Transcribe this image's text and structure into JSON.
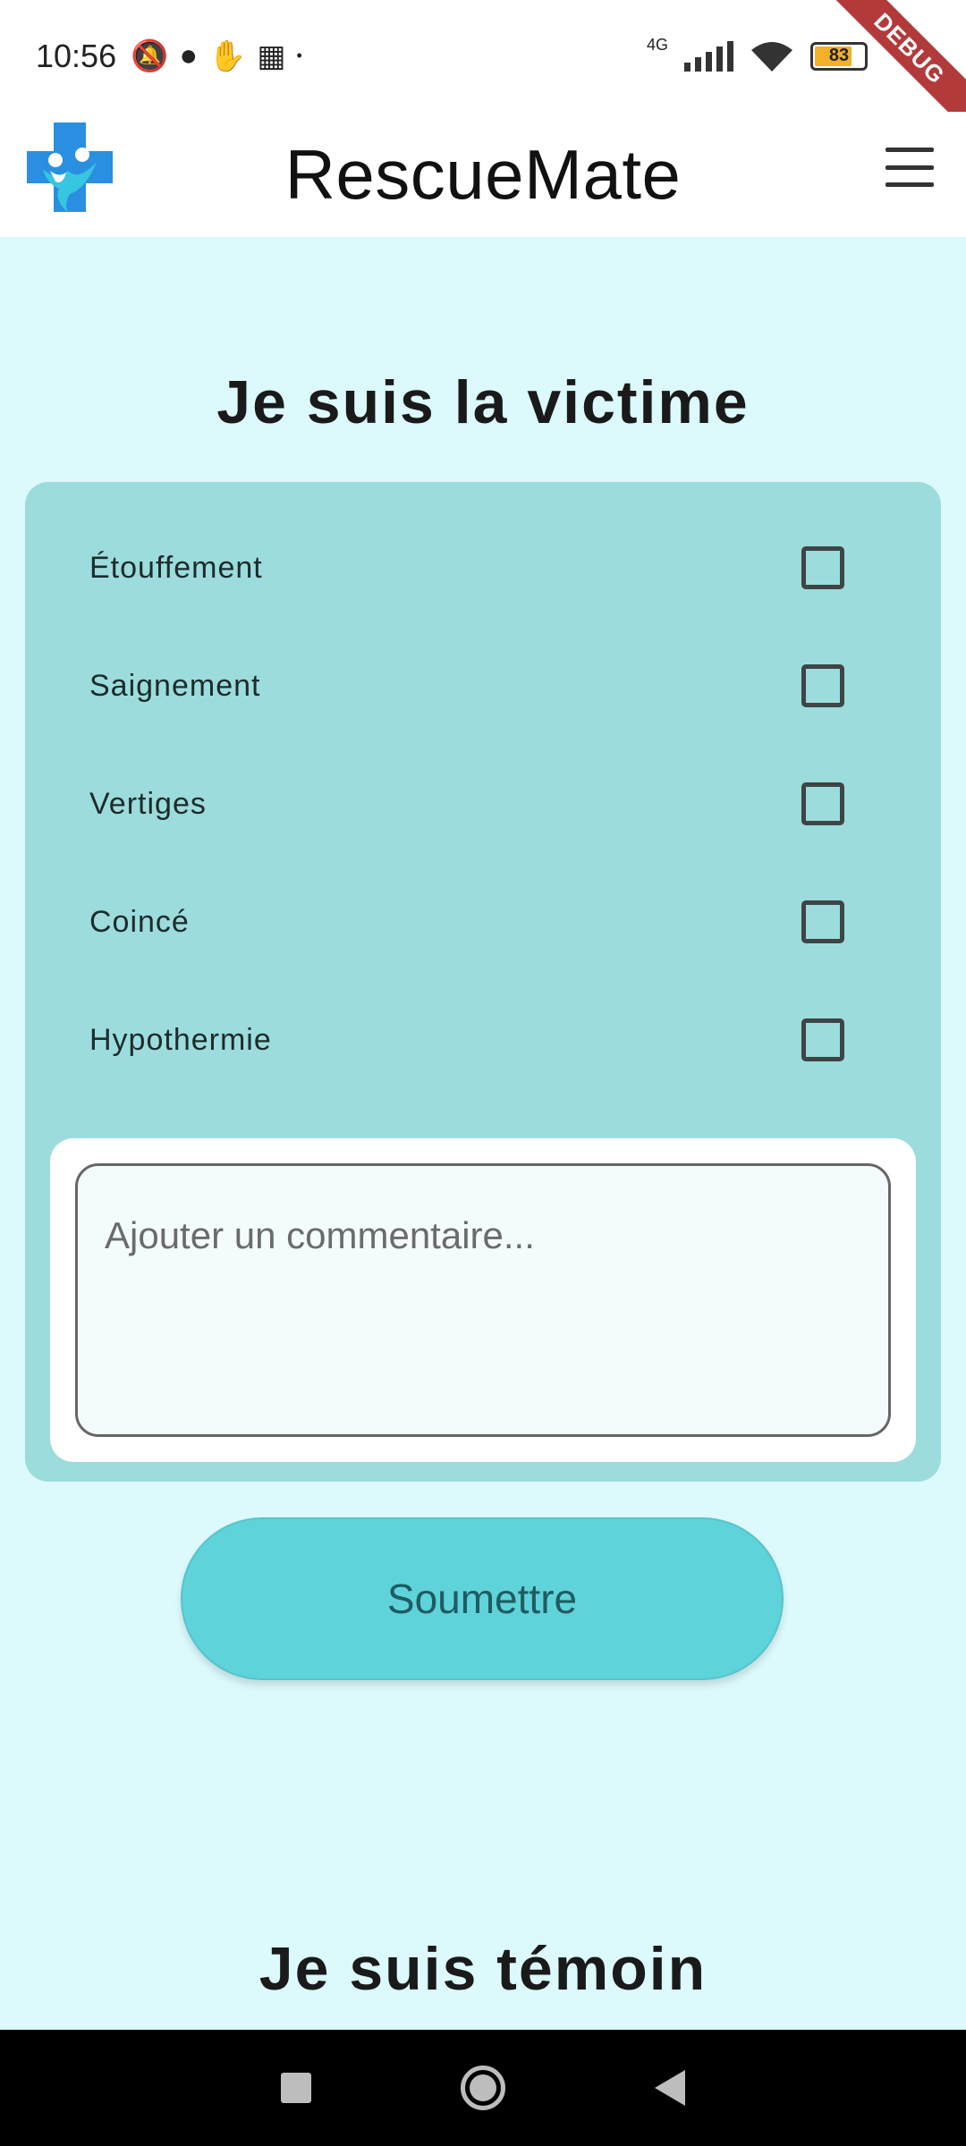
{
  "status_bar": {
    "time": "10:56",
    "network": "4G",
    "battery": "83",
    "debug_banner": "DEBUG"
  },
  "app_bar": {
    "title": "RescueMate",
    "logo_icon": "medical-cross-people-icon",
    "menu_icon": "hamburger-menu-icon"
  },
  "victim_section": {
    "title": "Je suis la victime",
    "options": [
      {
        "label": "Étouffement",
        "checked": false
      },
      {
        "label": "Saignement",
        "checked": false
      },
      {
        "label": "Vertiges",
        "checked": false
      },
      {
        "label": "Coincé",
        "checked": false
      },
      {
        "label": "Hypothermie",
        "checked": false
      }
    ],
    "comment_placeholder": "Ajouter un commentaire...",
    "submit_label": "Soumettre"
  },
  "witness_section": {
    "title": "Je suis témoin"
  },
  "colors": {
    "background": "#dcf9fb",
    "card": "#9cdcdc",
    "button": "#5fd3da",
    "button_text": "#1f5c62"
  }
}
